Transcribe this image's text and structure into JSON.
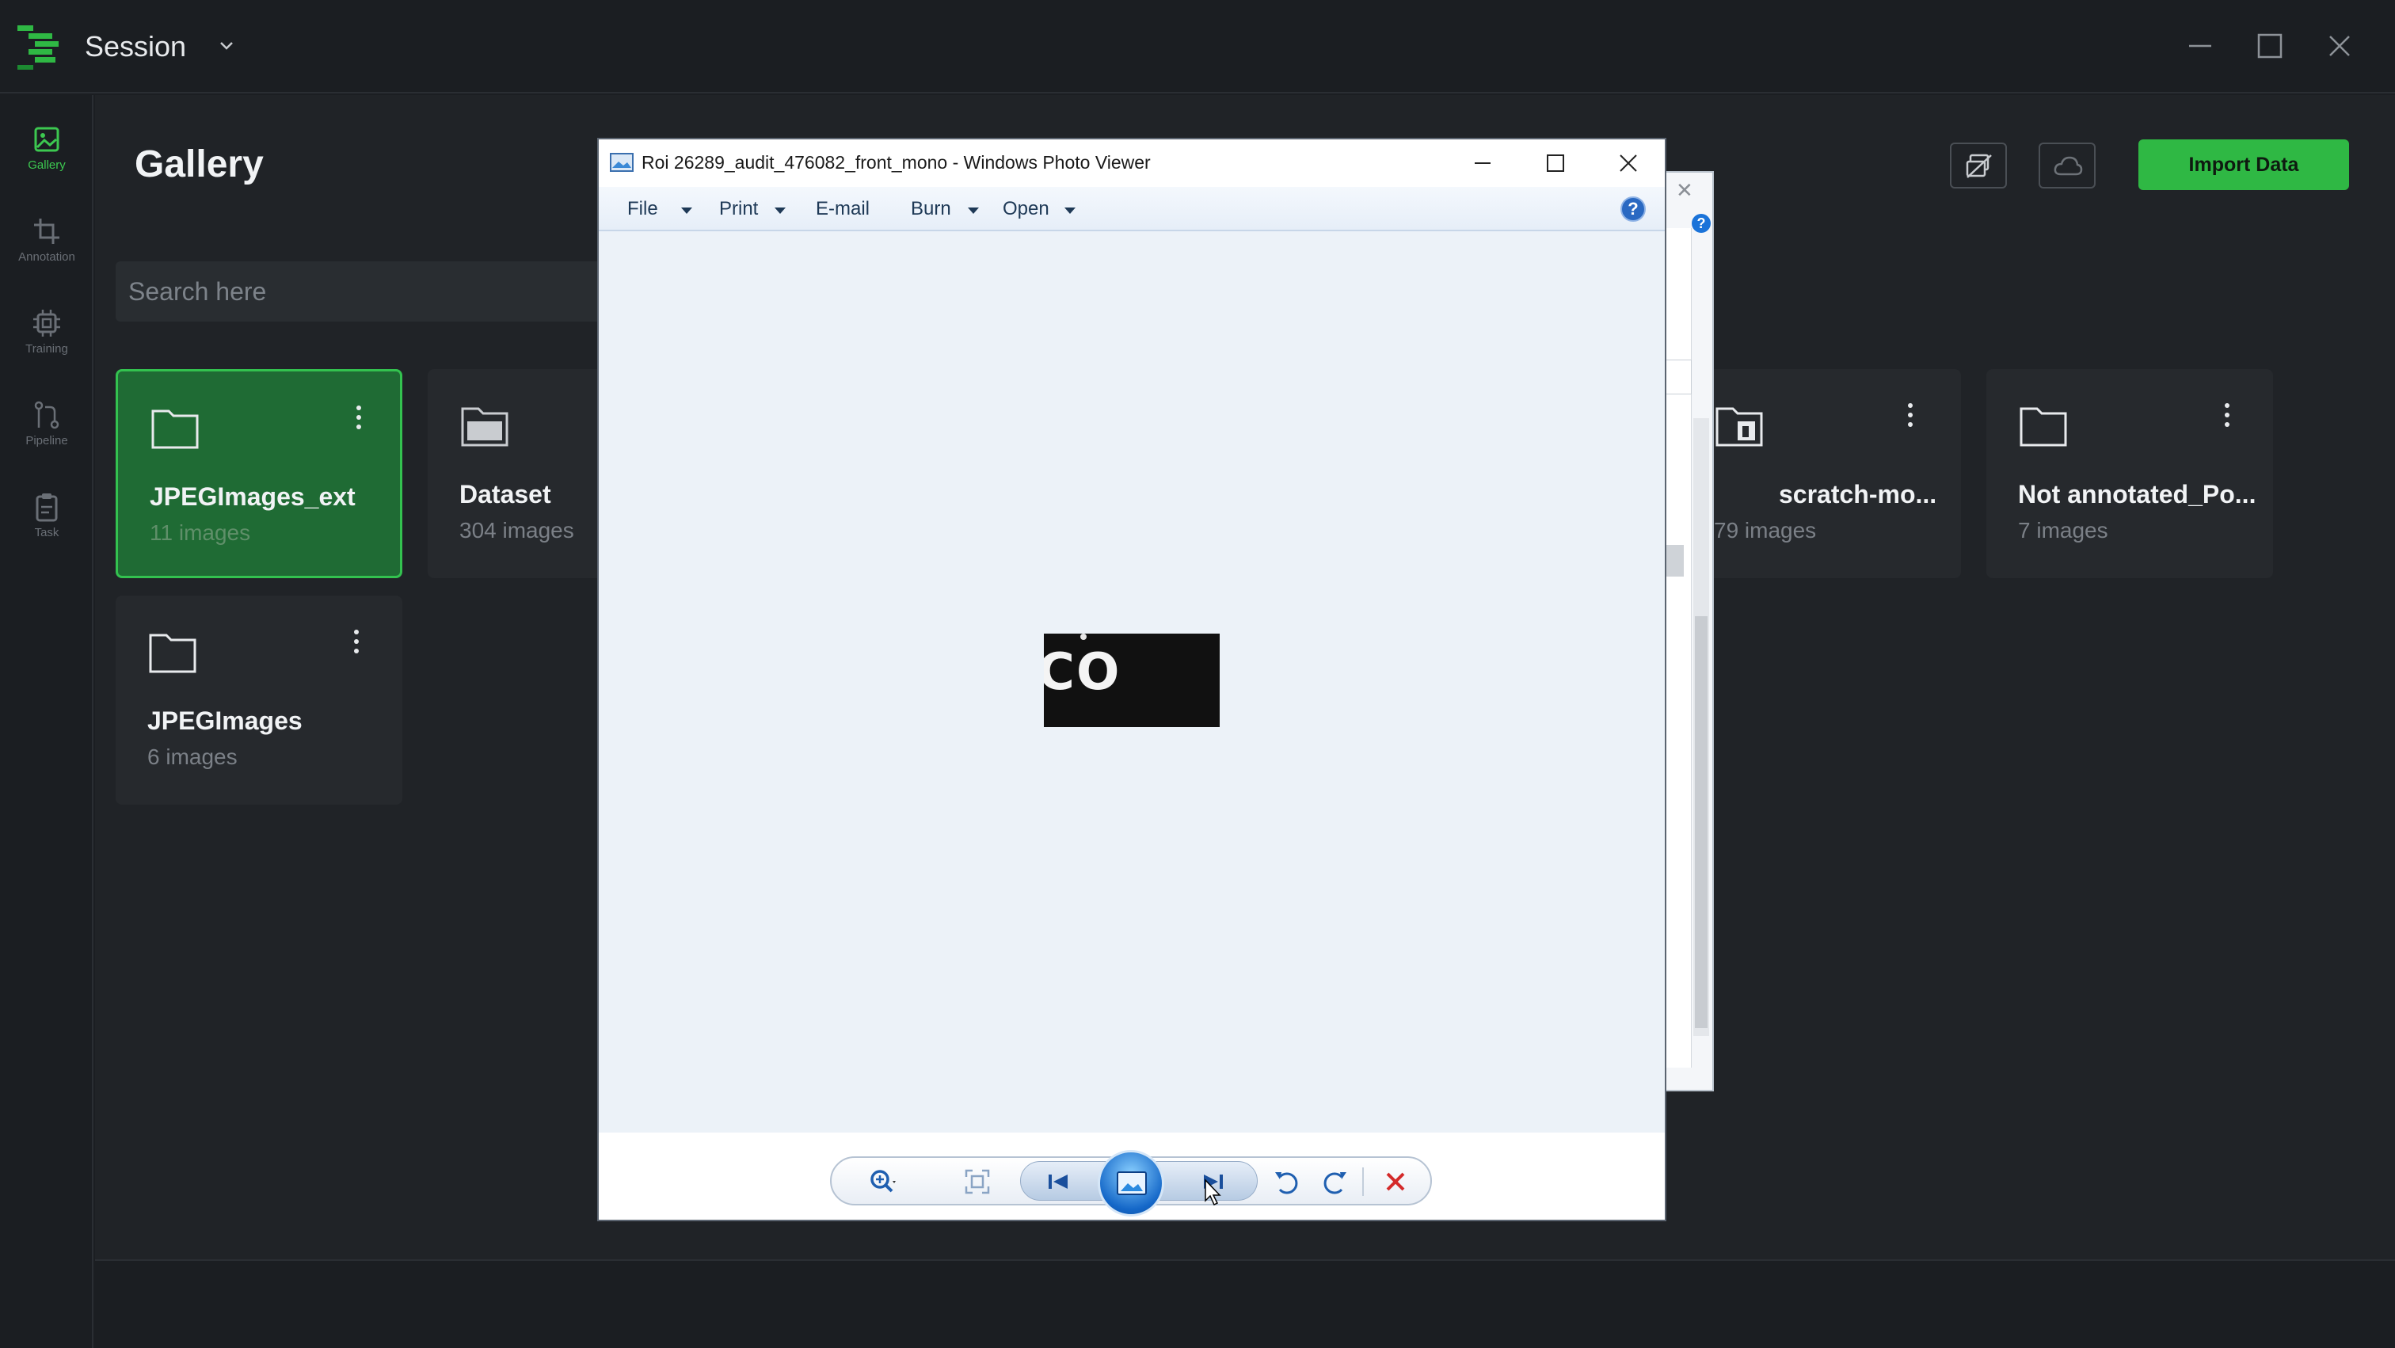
{
  "app": {
    "session_label": "Session"
  },
  "nav": {
    "items": [
      {
        "label": "Gallery",
        "icon": "image-icon",
        "active": true
      },
      {
        "label": "Annotation",
        "icon": "crop-icon",
        "active": false
      },
      {
        "label": "Training",
        "icon": "chip-icon",
        "active": false
      },
      {
        "label": "Pipeline",
        "icon": "pipeline-icon",
        "active": false
      },
      {
        "label": "Task",
        "icon": "clipboard-icon",
        "active": false
      }
    ]
  },
  "main": {
    "title": "Gallery",
    "search_placeholder": "Search here",
    "import_label": "Import Data"
  },
  "folders": [
    {
      "name": "JPEGImages_ext",
      "count": "11 images",
      "selected": true
    },
    {
      "name": "Dataset",
      "count": "304 images",
      "selected": false
    },
    {
      "name": "scratch-mo...",
      "count": "79 images",
      "selected": false
    },
    {
      "name": "Not annotated_Po...",
      "count": "7 images",
      "selected": false
    },
    {
      "name": "JPEGImages",
      "count": "6 images",
      "selected": false
    }
  ],
  "photo_viewer": {
    "title": "Roi 26289_audit_476082_front_mono - Windows Photo Viewer",
    "menu": [
      "File",
      "Print",
      "E-mail",
      "Burn",
      "Open"
    ],
    "help": "?",
    "photo_text": "CO"
  },
  "colors": {
    "accent": "#2fb844",
    "selected_card": "#1f6b34",
    "background": "#1b1e22"
  }
}
